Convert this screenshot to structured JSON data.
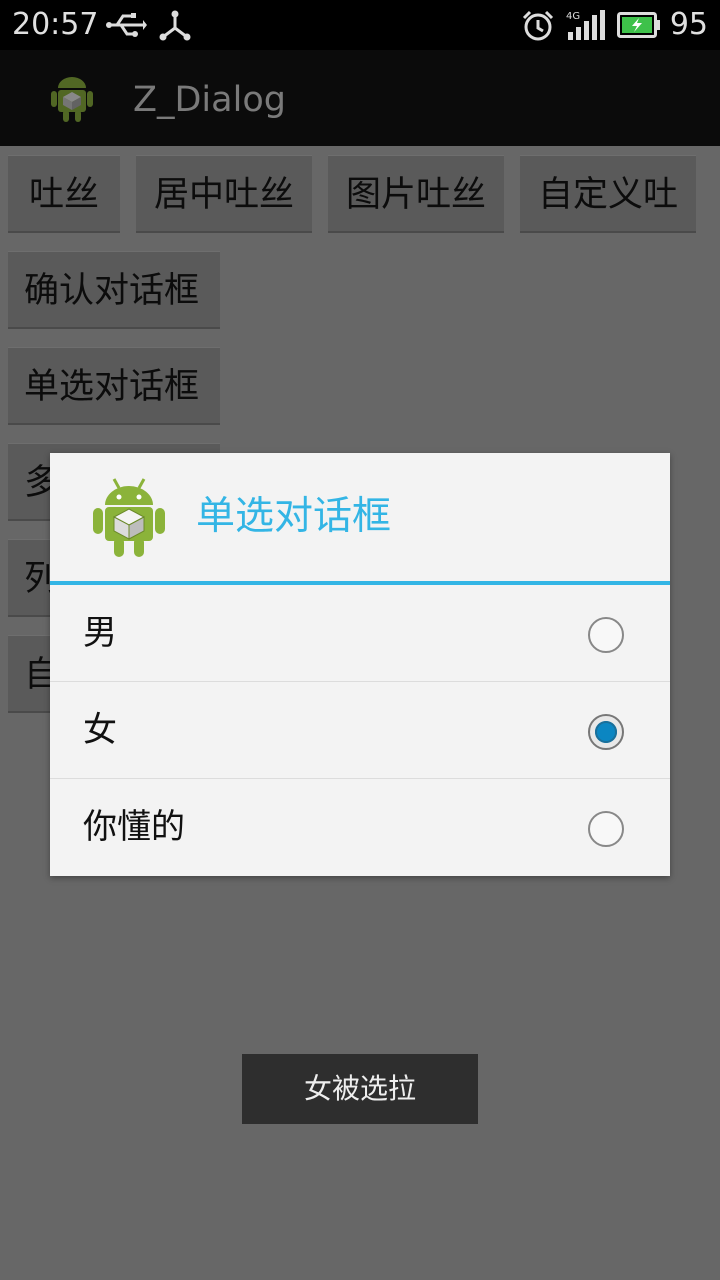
{
  "status_bar": {
    "time": "20:57",
    "battery_percent": "95",
    "network_label": "4G",
    "icons": [
      "usb-icon",
      "share-icon",
      "alarm-icon",
      "signal-icon",
      "battery-charging-icon"
    ]
  },
  "action_bar": {
    "title": "Z_Dialog",
    "logo_icon": "android-icon"
  },
  "buttons_row1": [
    {
      "label": "吐丝"
    },
    {
      "label": "居中吐丝"
    },
    {
      "label": "图片吐丝"
    },
    {
      "label": "自定义吐"
    }
  ],
  "buttons_list": [
    {
      "label": "确认对话框"
    },
    {
      "label": "单选对话框"
    },
    {
      "label": "多"
    },
    {
      "label": "列"
    },
    {
      "label": "自"
    }
  ],
  "dialog": {
    "title": "单选对话框",
    "icon": "android-box-icon",
    "accent_color": "#33b5e5",
    "options": [
      {
        "label": "男",
        "checked": false
      },
      {
        "label": "女",
        "checked": true
      },
      {
        "label": "你懂的",
        "checked": false
      }
    ]
  },
  "toast": {
    "text": "女被选拉"
  },
  "colors": {
    "background_dim": "#676767",
    "accent": "#33b5e5",
    "radio_checked": "#0b86c2"
  }
}
